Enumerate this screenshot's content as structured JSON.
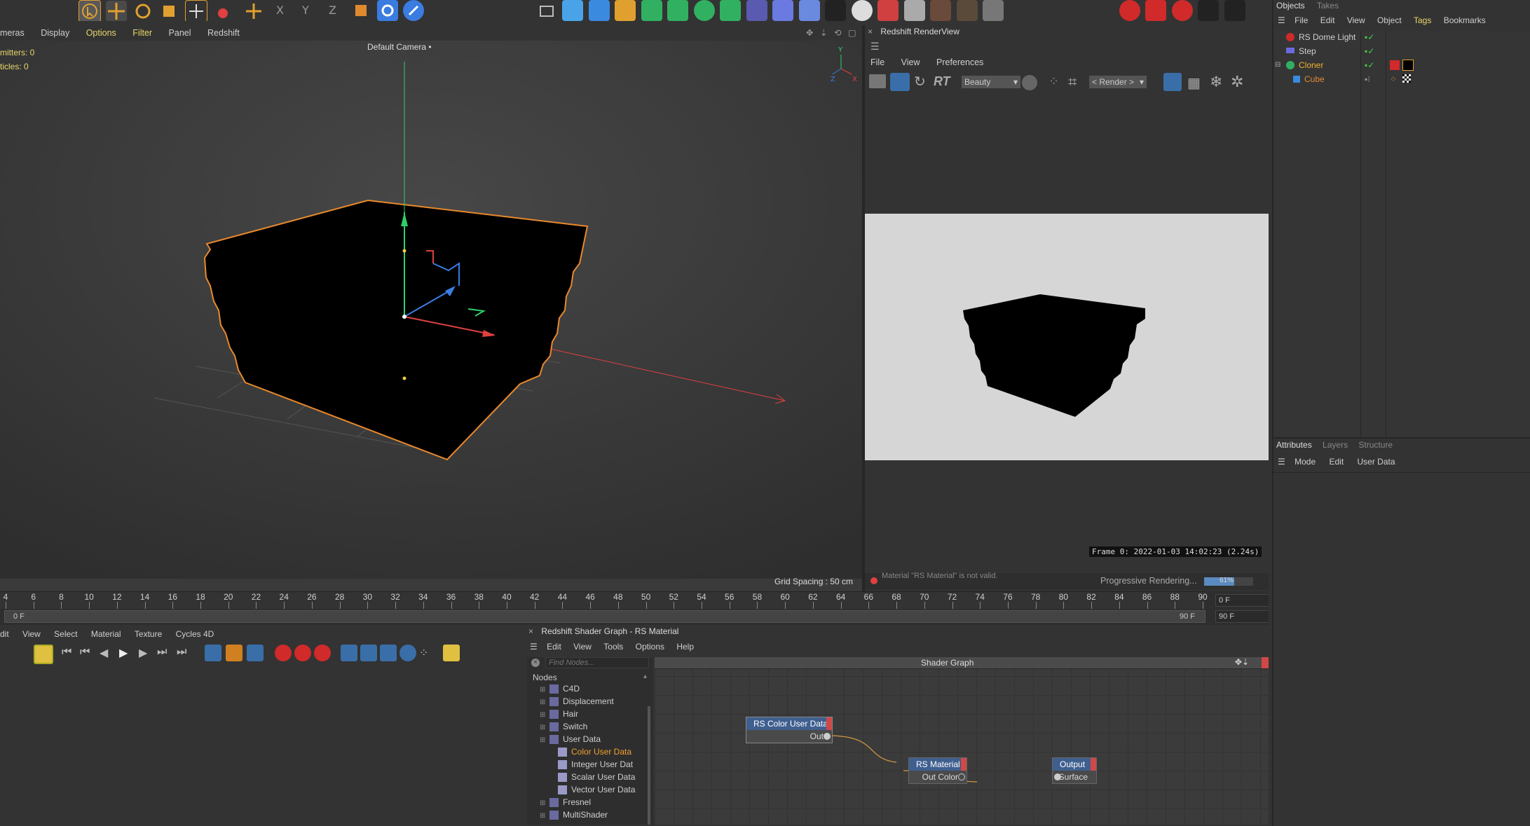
{
  "viewport": {
    "menu": [
      "meras",
      "Display",
      "Options",
      "Filter",
      "Panel",
      "Redshift"
    ],
    "menu_highlight": [
      "Options",
      "Filter"
    ],
    "hud_emitters": "mitters: 0",
    "hud_particles": "ticles: 0",
    "camera_label": "Default Camera",
    "grid_spacing": "Grid Spacing : 50 cm"
  },
  "renderview": {
    "title": "Redshift RenderView",
    "menu": [
      "File",
      "View",
      "Preferences"
    ],
    "aov_select": "Beauty",
    "render_select": "< Render >",
    "rt_label": "RT",
    "frame_info": "Frame  0:  2022-01-03  14:02:23  (2.24s)",
    "status_error": "Material \"RS Material\" is not valid.",
    "progress_label": "Progressive Rendering...",
    "progress_value": "61%",
    "progress_fraction": 0.61
  },
  "objects": {
    "tabs": [
      "Objects",
      "Takes"
    ],
    "menu": [
      "File",
      "Edit",
      "View",
      "Object",
      "Tags",
      "Bookmarks"
    ],
    "items": [
      {
        "label": "RS Dome Light",
        "color": "#cfcfcf",
        "indent": 0
      },
      {
        "label": "Step",
        "color": "#cfcfcf",
        "indent": 0
      },
      {
        "label": "Cloner",
        "color": "#f0b030",
        "indent": 0
      },
      {
        "label": "Cube",
        "color": "#e08a30",
        "indent": 1
      }
    ]
  },
  "attributes": {
    "tabs": [
      "Attributes",
      "Layers",
      "Structure"
    ],
    "menu": [
      "Mode",
      "Edit",
      "User Data"
    ]
  },
  "timeline": {
    "ticks": [
      "4",
      "6",
      "8",
      "10",
      "12",
      "14",
      "16",
      "18",
      "20",
      "22",
      "24",
      "26",
      "28",
      "30",
      "32",
      "34",
      "36",
      "38",
      "40",
      "42",
      "44",
      "46",
      "48",
      "50",
      "52",
      "54",
      "56",
      "58",
      "60",
      "62",
      "64",
      "66",
      "68",
      "70",
      "72",
      "74",
      "76",
      "78",
      "80",
      "82",
      "84",
      "86",
      "88",
      "90"
    ],
    "current_frame": "0 F",
    "start_frame": "0 F",
    "end_frame": "90 F",
    "end_field": "90 F"
  },
  "material_manager": {
    "menu": [
      "dit",
      "View",
      "Select",
      "Material",
      "Texture",
      "Cycles 4D"
    ]
  },
  "shader_graph": {
    "title": "Redshift Shader Graph - RS Material",
    "menu": [
      "Edit",
      "View",
      "Tools",
      "Options",
      "Help"
    ],
    "search_placeholder": "Find Nodes...",
    "nodes_header": "Nodes",
    "canvas_title": "Shader Graph",
    "tree": [
      {
        "label": "C4D",
        "indent": 0,
        "color": "#cfcfcf"
      },
      {
        "label": "Displacement",
        "indent": 0,
        "color": "#cfcfcf"
      },
      {
        "label": "Hair",
        "indent": 0,
        "color": "#cfcfcf"
      },
      {
        "label": "Switch",
        "indent": 0,
        "color": "#cfcfcf"
      },
      {
        "label": "User Data",
        "indent": 0,
        "color": "#cfcfcf"
      },
      {
        "label": "Color User Data",
        "indent": 1,
        "color": "#f0a030"
      },
      {
        "label": "Integer User Dat",
        "indent": 1,
        "color": "#cfcfcf"
      },
      {
        "label": "Scalar User Data",
        "indent": 1,
        "color": "#cfcfcf"
      },
      {
        "label": "Vector User Data",
        "indent": 1,
        "color": "#cfcfcf"
      },
      {
        "label": "Fresnel",
        "indent": 0,
        "color": "#cfcfcf"
      },
      {
        "label": "MultiShader",
        "indent": 0,
        "color": "#cfcfcf"
      }
    ],
    "graph_nodes": {
      "color_user_data": {
        "title": "RS Color User Data",
        "port": "Out"
      },
      "rs_material": {
        "title": "RS Material",
        "port": "Out Color"
      },
      "output": {
        "title": "Output",
        "port": "Surface"
      }
    }
  },
  "colors": {
    "accent_orange": "#f0a030",
    "selection_outline": "#e8892c",
    "axis_y": "#2fd06a",
    "axis_x": "#e04040",
    "axis_z": "#3a7ce0",
    "render_bg": "#d6d6d6"
  }
}
